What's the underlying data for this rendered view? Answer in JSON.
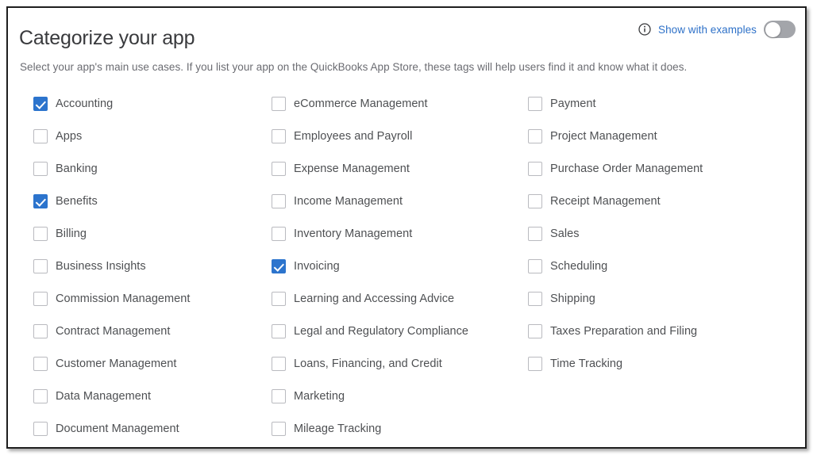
{
  "card": {
    "title": "Categorize your app",
    "subtitle": "Select your app's main use cases. If you list your app on the QuickBooks App Store, these tags will help users find it and know what it does."
  },
  "examples_control": {
    "info_icon": "info-circle-icon",
    "link_label": "Show with examples",
    "toggle_state": "off",
    "toggle_on": false
  },
  "colors": {
    "accent_blue": "#2c74cd",
    "link_blue": "#2e71c8",
    "toggle_track_off": "#a3a5aa",
    "checkbox_border": "#b9babf",
    "title_text": "#393a3d",
    "label_text": "#4e5053",
    "subtitle_text": "#6b6c72",
    "card_border": "#1f1f1f"
  },
  "columns": [
    {
      "items": [
        {
          "label": "Accounting",
          "checked": true
        },
        {
          "label": "Apps",
          "checked": false
        },
        {
          "label": "Banking",
          "checked": false
        },
        {
          "label": "Benefits",
          "checked": true
        },
        {
          "label": "Billing",
          "checked": false
        },
        {
          "label": "Business Insights",
          "checked": false
        },
        {
          "label": "Commission Management",
          "checked": false
        },
        {
          "label": "Contract Management",
          "checked": false
        },
        {
          "label": "Customer Management",
          "checked": false
        },
        {
          "label": "Data Management",
          "checked": false
        },
        {
          "label": "Document Management",
          "checked": false
        }
      ]
    },
    {
      "items": [
        {
          "label": "eCommerce Management",
          "checked": false
        },
        {
          "label": "Employees and Payroll",
          "checked": false
        },
        {
          "label": "Expense Management",
          "checked": false
        },
        {
          "label": "Income Management",
          "checked": false
        },
        {
          "label": "Inventory Management",
          "checked": false
        },
        {
          "label": "Invoicing",
          "checked": true
        },
        {
          "label": "Learning and Accessing Advice",
          "checked": false
        },
        {
          "label": "Legal and Regulatory Compliance",
          "checked": false
        },
        {
          "label": "Loans, Financing, and Credit",
          "checked": false
        },
        {
          "label": "Marketing",
          "checked": false
        },
        {
          "label": "Mileage Tracking",
          "checked": false
        }
      ]
    },
    {
      "items": [
        {
          "label": "Payment",
          "checked": false
        },
        {
          "label": "Project Management",
          "checked": false
        },
        {
          "label": "Purchase Order Management",
          "checked": false
        },
        {
          "label": "Receipt Management",
          "checked": false
        },
        {
          "label": "Sales",
          "checked": false
        },
        {
          "label": "Scheduling",
          "checked": false
        },
        {
          "label": "Shipping",
          "checked": false
        },
        {
          "label": "Taxes Preparation and Filing",
          "checked": false
        },
        {
          "label": "Time Tracking",
          "checked": false
        }
      ]
    }
  ]
}
